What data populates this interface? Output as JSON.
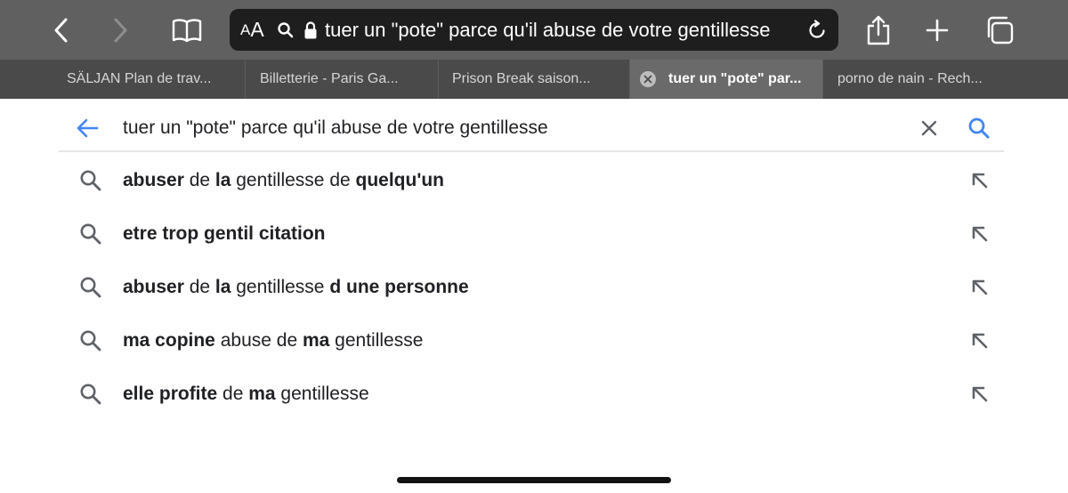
{
  "toolbar": {
    "reader_aa_small": "A",
    "reader_aa_large": "A",
    "url_text": "tuer un \"pote\" parce qu'il abuse de votre gentillesse",
    "icons": [
      "back-icon",
      "forward-icon",
      "bookmarks-icon",
      "search-icon",
      "lock-icon",
      "reload-icon",
      "share-icon",
      "new-tab-plus-icon",
      "tabs-overview-icon"
    ]
  },
  "tabs": [
    {
      "label": "SÄLJAN Plan de trav..."
    },
    {
      "label": "Billetterie - Paris Ga..."
    },
    {
      "label": "Prison Break saison..."
    },
    {
      "label": "tuer un \"pote\" par...",
      "active": true
    },
    {
      "label": "porno de nain - Rech..."
    }
  ],
  "search": {
    "query": "tuer un \"pote\" parce qu'il abuse de votre gentillesse"
  },
  "suggestions": [
    {
      "parts": [
        {
          "t": "abuser",
          "b": true
        },
        {
          "t": " de ",
          "b": false
        },
        {
          "t": "la",
          "b": true
        },
        {
          "t": " gentillesse de ",
          "b": false
        },
        {
          "t": "quelqu'un",
          "b": true
        }
      ]
    },
    {
      "parts": [
        {
          "t": "etre trop gentil citation",
          "b": true
        }
      ]
    },
    {
      "parts": [
        {
          "t": "abuser",
          "b": true
        },
        {
          "t": " de ",
          "b": false
        },
        {
          "t": "la",
          "b": true
        },
        {
          "t": " gentillesse ",
          "b": false
        },
        {
          "t": "d une personne",
          "b": true
        }
      ]
    },
    {
      "parts": [
        {
          "t": "ma copine",
          "b": true
        },
        {
          "t": " abuse de ",
          "b": false
        },
        {
          "t": "ma",
          "b": true
        },
        {
          "t": " gentillesse",
          "b": false
        }
      ]
    },
    {
      "parts": [
        {
          "t": "elle profite",
          "b": true
        },
        {
          "t": " de ",
          "b": false
        },
        {
          "t": "ma",
          "b": true
        },
        {
          "t": " gentillesse",
          "b": false
        }
      ]
    }
  ],
  "colors": {
    "toolbar_bg": "#606060",
    "tabstrip_bg": "#4a4a4a",
    "active_tab_bg": "#6a6a6a",
    "google_blue": "#4285f4",
    "icon_gray": "#5f6368"
  }
}
